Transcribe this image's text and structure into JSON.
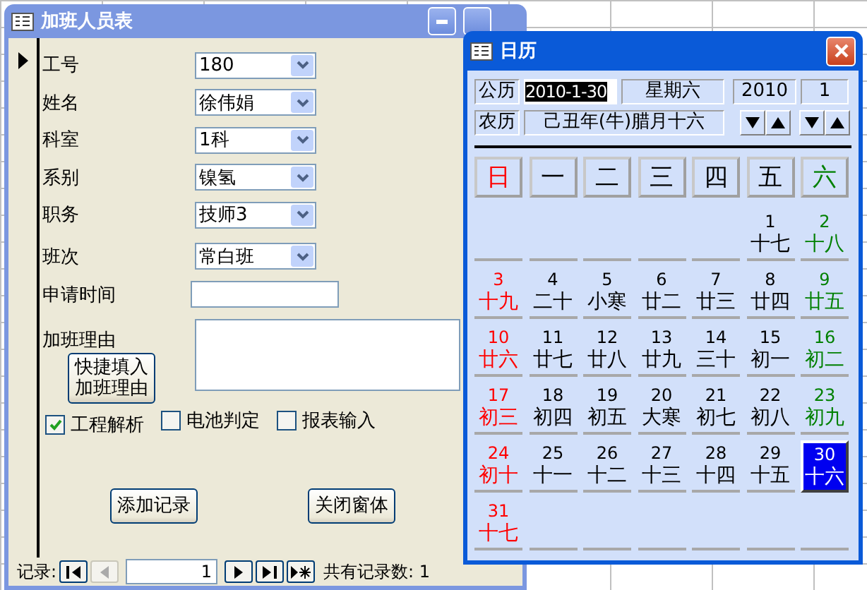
{
  "form_window": {
    "title": "加班人员表",
    "fields": [
      {
        "label": "工号",
        "kind": "combo",
        "value": "180"
      },
      {
        "label": "姓名",
        "kind": "combo",
        "value": "徐伟娟"
      },
      {
        "label": "科室",
        "kind": "combo",
        "value": "1科"
      },
      {
        "label": "系别",
        "kind": "combo",
        "value": "镍氢"
      },
      {
        "label": "职务",
        "kind": "combo",
        "value": "技师3"
      },
      {
        "label": "班次",
        "kind": "combo",
        "value": "常白班"
      },
      {
        "label": "申请时间",
        "kind": "text"
      },
      {
        "label": "加班理由",
        "kind": "memo",
        "button": "快捷填入加班理由"
      }
    ],
    "checkboxes": [
      {
        "label": "工程解析",
        "checked": true
      },
      {
        "label": "电池判定",
        "checked": false
      },
      {
        "label": "报表输入",
        "checked": false
      }
    ],
    "buttons": [
      "添加记录",
      "关闭窗体"
    ],
    "record_nav": {
      "label": "记录:",
      "current": "1",
      "total": "共有记录数: 1"
    }
  },
  "calendar": {
    "title": "日历",
    "solar_label": "公历",
    "date": "2010-1-30",
    "weekday": "星期六",
    "year": "2010",
    "month": "1",
    "lunar_label": "农历",
    "lunar_date": "己丑年(牛)腊月十六",
    "weekdays": [
      {
        "label": "日",
        "color": "#ff0000"
      },
      {
        "label": "一",
        "color": "#000000"
      },
      {
        "label": "二",
        "color": "#000000"
      },
      {
        "label": "三",
        "color": "#000000"
      },
      {
        "label": "四",
        "color": "#000000"
      },
      {
        "label": "五",
        "color": "#000000"
      },
      {
        "label": "六",
        "color": "#008000"
      }
    ],
    "weeks": [
      [
        {
          "kind": "blank"
        },
        {
          "kind": "blank"
        },
        {
          "kind": "blank"
        },
        {
          "kind": "blank"
        },
        {
          "kind": "blank"
        },
        {
          "kind": "day",
          "day": "1",
          "lunar": "十七",
          "color": "#000000",
          "selected": false
        },
        {
          "kind": "day",
          "day": "2",
          "lunar": "十八",
          "color": "#008000",
          "selected": false
        }
      ],
      [
        {
          "kind": "day",
          "day": "3",
          "lunar": "十九",
          "color": "#ff0000",
          "selected": false
        },
        {
          "kind": "day",
          "day": "4",
          "lunar": "二十",
          "color": "#000000",
          "selected": false
        },
        {
          "kind": "day",
          "day": "5",
          "lunar": "小寒",
          "color": "#000000",
          "selected": false
        },
        {
          "kind": "day",
          "day": "6",
          "lunar": "廿二",
          "color": "#000000",
          "selected": false
        },
        {
          "kind": "day",
          "day": "7",
          "lunar": "廿三",
          "color": "#000000",
          "selected": false
        },
        {
          "kind": "day",
          "day": "8",
          "lunar": "廿四",
          "color": "#000000",
          "selected": false
        },
        {
          "kind": "day",
          "day": "9",
          "lunar": "廿五",
          "color": "#008000",
          "selected": false
        }
      ],
      [
        {
          "kind": "day",
          "day": "10",
          "lunar": "廿六",
          "color": "#ff0000",
          "selected": false
        },
        {
          "kind": "day",
          "day": "11",
          "lunar": "廿七",
          "color": "#000000",
          "selected": false
        },
        {
          "kind": "day",
          "day": "12",
          "lunar": "廿八",
          "color": "#000000",
          "selected": false
        },
        {
          "kind": "day",
          "day": "13",
          "lunar": "廿九",
          "color": "#000000",
          "selected": false
        },
        {
          "kind": "day",
          "day": "14",
          "lunar": "三十",
          "color": "#000000",
          "selected": false
        },
        {
          "kind": "day",
          "day": "15",
          "lunar": "初一",
          "color": "#000000",
          "selected": false
        },
        {
          "kind": "day",
          "day": "16",
          "lunar": "初二",
          "color": "#008000",
          "selected": false
        }
      ],
      [
        {
          "kind": "day",
          "day": "17",
          "lunar": "初三",
          "color": "#ff0000",
          "selected": false
        },
        {
          "kind": "day",
          "day": "18",
          "lunar": "初四",
          "color": "#000000",
          "selected": false
        },
        {
          "kind": "day",
          "day": "19",
          "lunar": "初五",
          "color": "#000000",
          "selected": false
        },
        {
          "kind": "day",
          "day": "20",
          "lunar": "大寒",
          "color": "#000000",
          "selected": false
        },
        {
          "kind": "day",
          "day": "21",
          "lunar": "初七",
          "color": "#000000",
          "selected": false
        },
        {
          "kind": "day",
          "day": "22",
          "lunar": "初八",
          "color": "#000000",
          "selected": false
        },
        {
          "kind": "day",
          "day": "23",
          "lunar": "初九",
          "color": "#008000",
          "selected": false
        }
      ],
      [
        {
          "kind": "day",
          "day": "24",
          "lunar": "初十",
          "color": "#ff0000",
          "selected": false
        },
        {
          "kind": "day",
          "day": "25",
          "lunar": "十一",
          "color": "#000000",
          "selected": false
        },
        {
          "kind": "day",
          "day": "26",
          "lunar": "十二",
          "color": "#000000",
          "selected": false
        },
        {
          "kind": "day",
          "day": "27",
          "lunar": "十三",
          "color": "#000000",
          "selected": false
        },
        {
          "kind": "day",
          "day": "28",
          "lunar": "十四",
          "color": "#000000",
          "selected": false
        },
        {
          "kind": "day",
          "day": "29",
          "lunar": "十五",
          "color": "#000000",
          "selected": false
        },
        {
          "kind": "day",
          "day": "30",
          "lunar": "十六",
          "selected": true
        }
      ],
      [
        {
          "kind": "day",
          "day": "31",
          "lunar": "十七",
          "color": "#ff0000",
          "selected": false
        },
        {
          "kind": "blank"
        },
        {
          "kind": "blank"
        },
        {
          "kind": "blank"
        },
        {
          "kind": "blank"
        },
        {
          "kind": "blank"
        },
        {
          "kind": "blank"
        }
      ]
    ]
  }
}
